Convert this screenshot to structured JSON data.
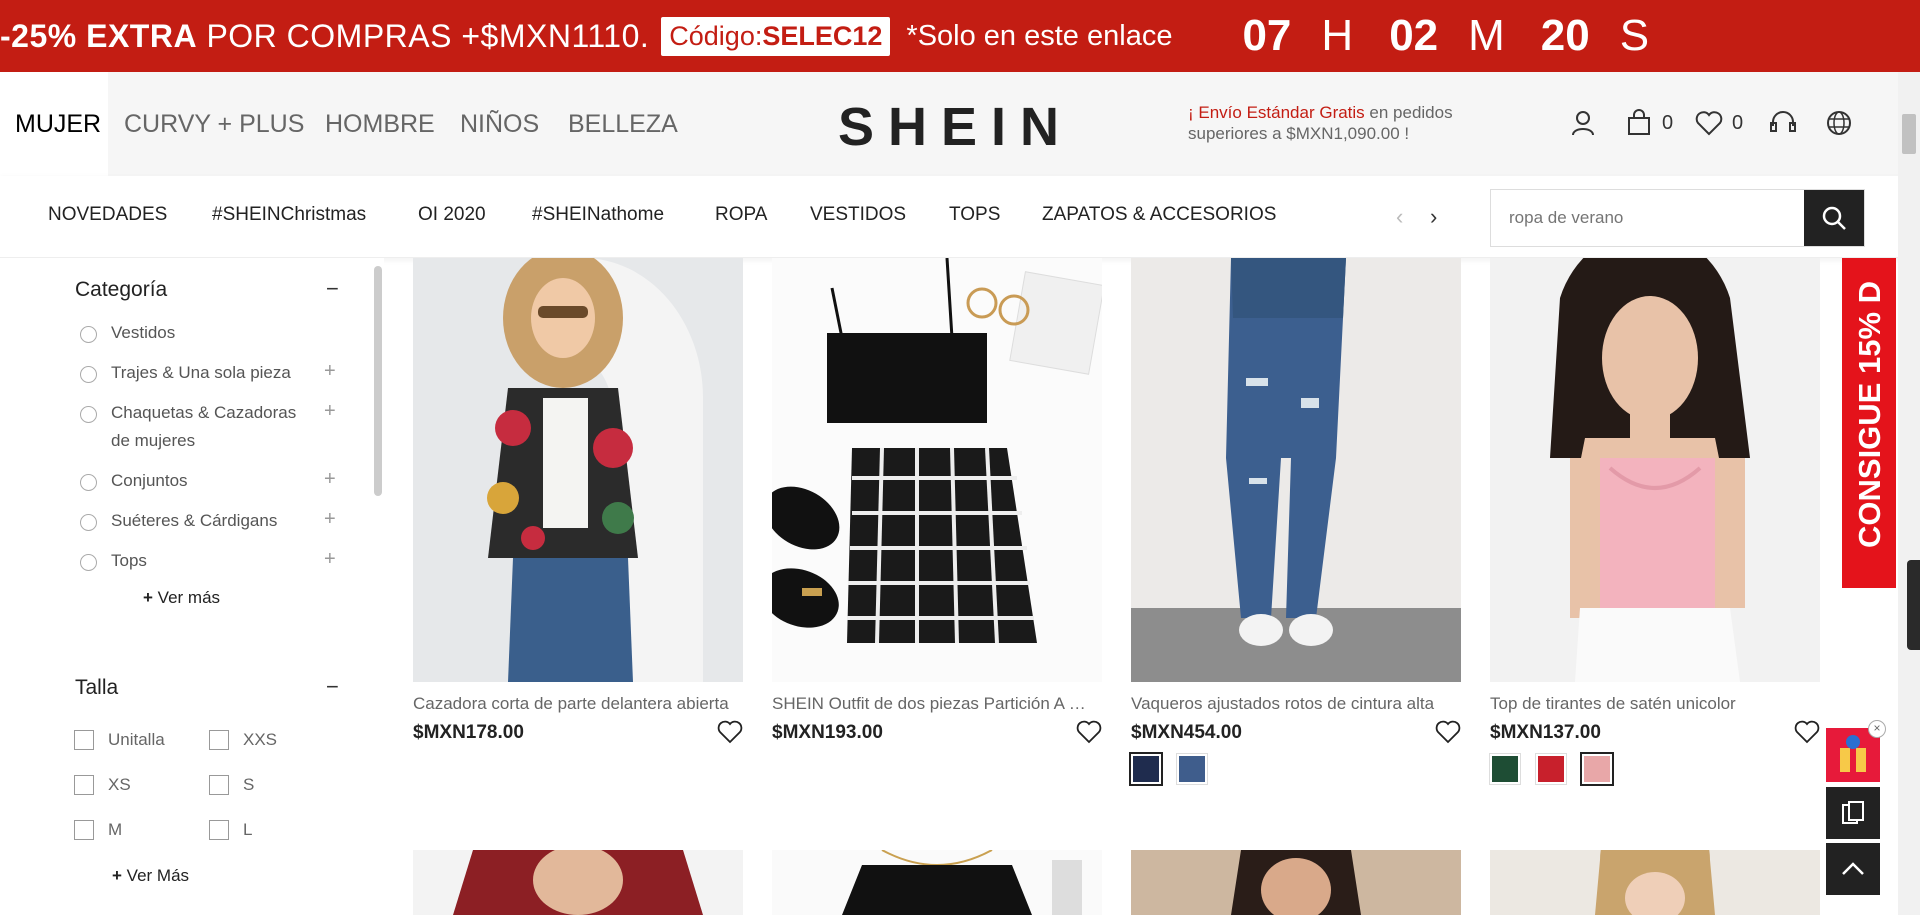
{
  "promo": {
    "text_bold": "-25% EXTRA",
    "text_rest": "POR COMPRAS +$MXN1110.",
    "code_label": "Código:",
    "code_value": "SELEC12",
    "note": "*Solo en este enlace",
    "countdown": [
      {
        "value": "07",
        "unit": "H"
      },
      {
        "value": "02",
        "unit": "M"
      },
      {
        "value": "20",
        "unit": "S"
      }
    ]
  },
  "header": {
    "categories": [
      "MUJER",
      "CURVY + PLUS",
      "HOMBRE",
      "NIÑOS",
      "BELLEZA"
    ],
    "logo": "SHEIN",
    "shipping_highlight": "¡ Envío Estándar Gratis",
    "shipping_rest": " en pedidos superiores a $MXN1,090.00 !",
    "cart_count": "0",
    "wishlist_count": "0"
  },
  "subnav": {
    "items": [
      "NOVEDADES",
      "#SHEINChristmas",
      "OI 2020",
      "#SHEINathome",
      "ROPA",
      "VESTIDOS",
      "TOPS",
      "ZAPATOS & ACCESORIOS"
    ],
    "prev": "‹",
    "next": "›",
    "search_placeholder": "ropa de verano"
  },
  "sidebar": {
    "category_title": "Categoría",
    "categories": [
      {
        "label": "Vestidos",
        "expandable": false
      },
      {
        "label": "Trajes & Una sola pieza",
        "expandable": true
      },
      {
        "label": "Chaquetas & Cazadoras de mujeres",
        "expandable": true
      },
      {
        "label": "Conjuntos",
        "expandable": true
      },
      {
        "label": "Suéteres & Cárdigans",
        "expandable": true
      },
      {
        "label": "Tops",
        "expandable": true
      }
    ],
    "category_more": "Ver más",
    "size_title": "Talla",
    "sizes": [
      "Unitalla",
      "XXS",
      "XS",
      "S",
      "M",
      "L"
    ],
    "size_more": "Ver Más",
    "collapse_symbol": "−",
    "expand_symbol": "+"
  },
  "products": [
    {
      "title": "Cazadora corta de parte delantera abierta",
      "price": "$MXN178.00",
      "swatches": []
    },
    {
      "title": "SHEIN Outfit de dos piezas Partición A cuadros",
      "price": "$MXN193.00",
      "swatches": []
    },
    {
      "title": "Vaqueros ajustados rotos de cintura alta",
      "price": "$MXN454.00",
      "swatches": [
        "#1f2c4e",
        "#3f5d8c"
      ]
    },
    {
      "title": "Top de tirantes de satén unicolor",
      "price": "$MXN137.00",
      "swatches": [
        "#1e4d34",
        "#c8202c",
        "#e8a7a8"
      ]
    }
  ],
  "side_banner": "CONSIGUE 15% D",
  "colors": {
    "promo_red": "#c31d13",
    "banner_red": "#e4131b",
    "dark": "#222222"
  }
}
